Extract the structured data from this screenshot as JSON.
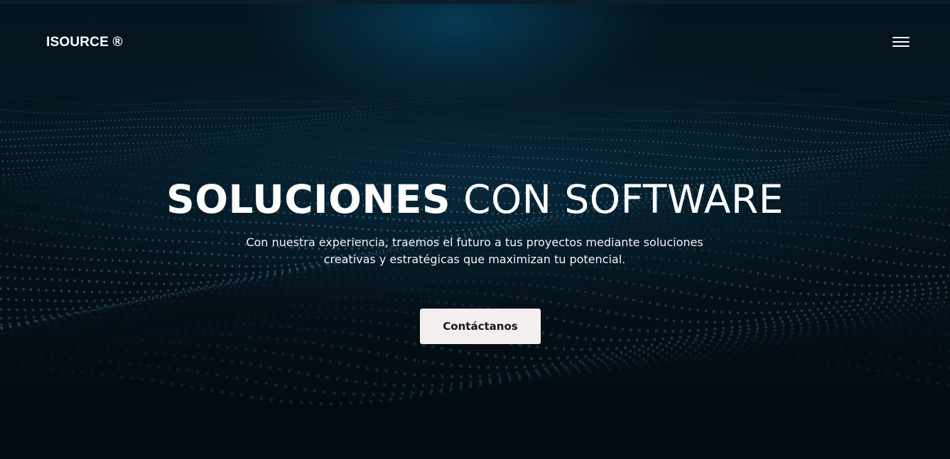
{
  "header": {
    "logo_text": "ISOURCE ®",
    "menu_icon": "hamburger-icon"
  },
  "hero": {
    "headline_bold": "SOLUCIONES",
    "headline_light": "CON SOFTWARE",
    "subtitle": "Con nuestra experiencia, traemos el futuro a tus proyectos mediante soluciones creativas y estratégicas que maximizan tu potencial.",
    "cta_label": "Contáctanos",
    "background_decoration": "particle-wave"
  },
  "colors": {
    "background": "#030a12",
    "glow": "#0a4664",
    "text": "#ffffff",
    "button_bg": "#f4eeee",
    "button_text": "#161616",
    "particles": "#5ab4d2"
  }
}
